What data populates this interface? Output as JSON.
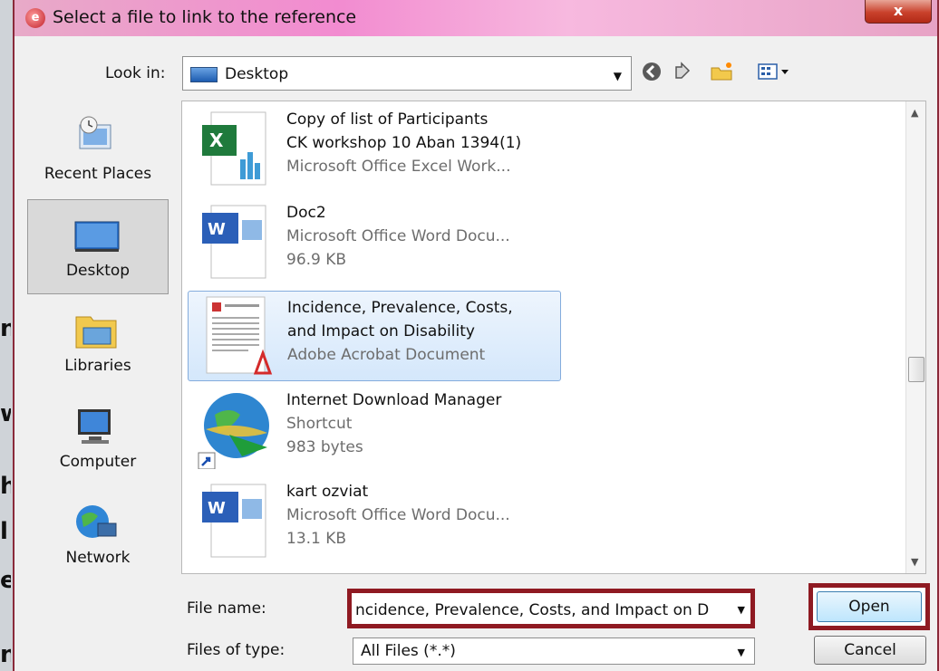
{
  "window": {
    "title": "Select a file to link to the reference",
    "close": "x"
  },
  "lookin": {
    "label": "Look in:",
    "value": "Desktop"
  },
  "toolbar": {
    "icons": [
      "back-icon",
      "up-folder-icon",
      "new-folder-icon",
      "views-menu-icon"
    ]
  },
  "places": [
    {
      "label": "Recent Places"
    },
    {
      "label": "Desktop",
      "selected": true
    },
    {
      "label": "Libraries"
    },
    {
      "label": "Computer"
    },
    {
      "label": "Network"
    }
  ],
  "files": [
    {
      "line1": "Copy of list of  Participants",
      "line2": "CK workshop 10 Aban 1394(1)",
      "line3": "Microsoft Office Excel Work...",
      "icon": "excel-icon"
    },
    {
      "line1": "Doc2",
      "line2": "Microsoft Office Word Docu...",
      "line3": "96.9 KB",
      "icon": "word-icon"
    },
    {
      "line1": "Incidence, Prevalence, Costs,",
      "line2": "and Impact on Disability",
      "line3": "Adobe Acrobat Document",
      "icon": "pdf-icon",
      "selected": true
    },
    {
      "line1": "Internet Download Manager",
      "line2": "Shortcut",
      "line3": "983 bytes",
      "icon": "idm-shortcut-icon"
    },
    {
      "line1": "kart ozviat",
      "line2": "Microsoft Office Word Docu...",
      "line3": "13.1 KB",
      "icon": "word-icon"
    }
  ],
  "filename": {
    "label": "File name:",
    "value": "ncidence, Prevalence, Costs, and Impact on D"
  },
  "filetype": {
    "label": "Files of type:",
    "value": "All Files (*.*)"
  },
  "buttons": {
    "open": "Open",
    "cancel": "Cancel"
  },
  "colors": {
    "highlight_border": "#8f1a22",
    "titlebar": "#f28bd0",
    "selection": "#d4e7fb"
  }
}
